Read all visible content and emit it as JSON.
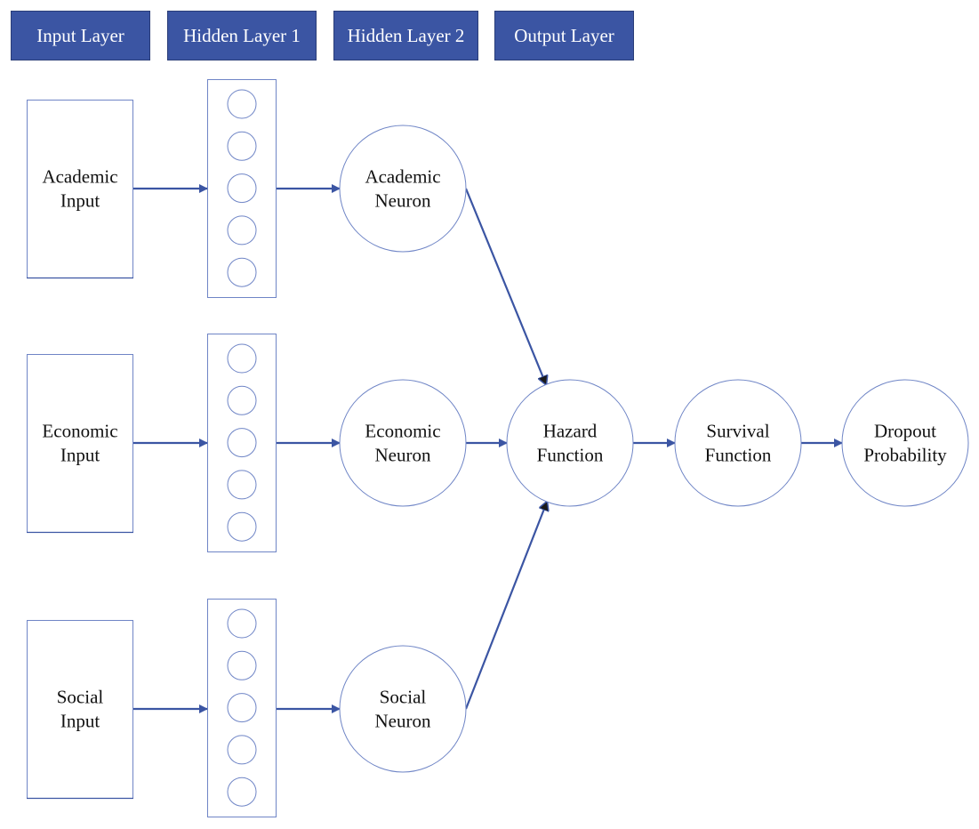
{
  "colors": {
    "header_fill": "#3b55a3",
    "header_text": "#ffffff",
    "outline": "#6f85c6",
    "arrow": "#3b55a3",
    "arrowhead_dark": "#1a1a1a",
    "text": "#111111"
  },
  "headers": [
    {
      "id": "input-layer",
      "label": "Input Layer"
    },
    {
      "id": "hidden-layer-1",
      "label": "Hidden Layer 1"
    },
    {
      "id": "hidden-layer-2",
      "label": "Hidden Layer 2"
    },
    {
      "id": "output-layer",
      "label": "Output Layer"
    }
  ],
  "input_nodes": [
    {
      "id": "academic-input",
      "lines": [
        "Academic",
        "Input"
      ]
    },
    {
      "id": "economic-input",
      "lines": [
        "Economic",
        "Input"
      ]
    },
    {
      "id": "social-input",
      "lines": [
        "Social",
        "Input"
      ]
    }
  ],
  "hidden_layer_1": {
    "groups": 3,
    "neurons_per_group": 5
  },
  "hidden_layer_2": [
    {
      "id": "academic-neuron",
      "lines": [
        "Academic",
        "Neuron"
      ]
    },
    {
      "id": "economic-neuron",
      "lines": [
        "Economic",
        "Neuron"
      ]
    },
    {
      "id": "social-neuron",
      "lines": [
        "Social",
        "Neuron"
      ]
    }
  ],
  "output_nodes": [
    {
      "id": "hazard-function",
      "lines": [
        "Hazard",
        "Function"
      ]
    },
    {
      "id": "survival-function",
      "lines": [
        "Survival",
        "Function"
      ]
    },
    {
      "id": "dropout-probability",
      "lines": [
        "Dropout",
        "Probability"
      ]
    }
  ],
  "edges": [
    {
      "from": "academic-input",
      "to": "hidden-group-1"
    },
    {
      "from": "economic-input",
      "to": "hidden-group-2"
    },
    {
      "from": "social-input",
      "to": "hidden-group-3"
    },
    {
      "from": "hidden-group-1",
      "to": "academic-neuron"
    },
    {
      "from": "hidden-group-2",
      "to": "economic-neuron"
    },
    {
      "from": "hidden-group-3",
      "to": "social-neuron"
    },
    {
      "from": "academic-neuron",
      "to": "hazard-function"
    },
    {
      "from": "economic-neuron",
      "to": "hazard-function"
    },
    {
      "from": "social-neuron",
      "to": "hazard-function"
    },
    {
      "from": "hazard-function",
      "to": "survival-function"
    },
    {
      "from": "survival-function",
      "to": "dropout-probability"
    }
  ]
}
